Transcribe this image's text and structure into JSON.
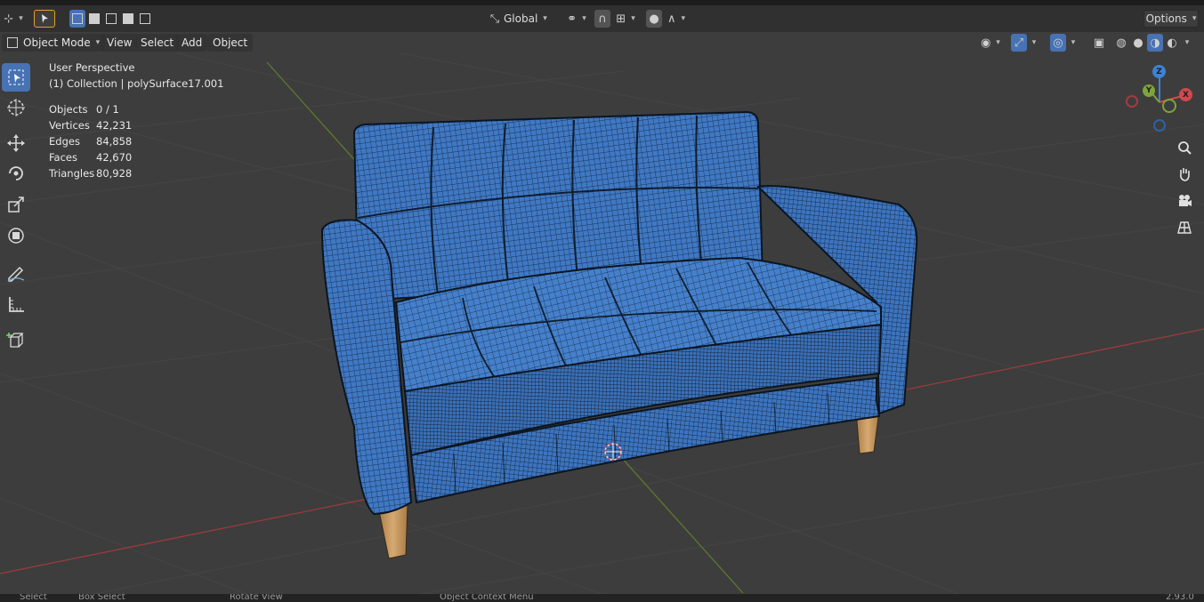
{
  "toolbar": {
    "orientation": "Global",
    "options": "Options"
  },
  "header": {
    "mode": "Object Mode",
    "menus": [
      "View",
      "Select",
      "Add",
      "Object"
    ]
  },
  "viewport": {
    "view_name": "User Perspective",
    "collection": "(1) Collection | polySurface17.001"
  },
  "stats": [
    {
      "label": "Objects",
      "value": "0 / 1"
    },
    {
      "label": "Vertices",
      "value": "42,231"
    },
    {
      "label": "Edges",
      "value": "84,858"
    },
    {
      "label": "Faces",
      "value": "42,670"
    },
    {
      "label": "Triangles",
      "value": "80,928"
    }
  ],
  "gizmo": {
    "x": "X",
    "y": "Y",
    "z": "Z"
  },
  "statusbar": {
    "select": "Select",
    "box_select": "Box Select",
    "rotate_view": "Rotate View",
    "context_menu": "Object Context Menu",
    "version": "2.93.0"
  },
  "colors": {
    "mesh_fill": "#3f78c4",
    "wire": "#0f1c2c",
    "selection": "#4772b3",
    "x_axis": "#d0484e",
    "y_axis": "#7ea43a",
    "z_axis": "#3d82d6",
    "leg": "#c89a63"
  }
}
